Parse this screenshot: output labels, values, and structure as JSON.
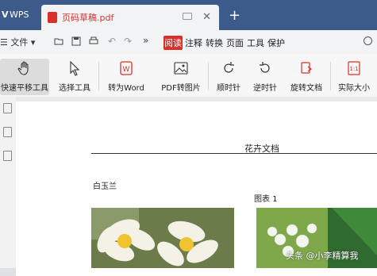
{
  "titlebar": {
    "wps_tab": "WPS",
    "doc_tab": "页码草稿.pdf",
    "new_tab": "+"
  },
  "menubar": {
    "file_label": "文件",
    "tabs": [
      "阅读",
      "注释",
      "转换",
      "页面",
      "工具",
      "保护"
    ],
    "active_tab": "阅读"
  },
  "toolbar": {
    "hand_tool": "快速平移工具",
    "select_tool": "选择工具",
    "to_word": "转为Word",
    "pdf_to_image": "PDF转图片",
    "rotate_cw": "顺时针",
    "rotate_ccw": "逆时针",
    "rotate_doc": "旋转文档",
    "actual_size": "实际大小"
  },
  "document": {
    "title": "花卉文档",
    "heading": "白玉兰",
    "caption": "图表 1"
  },
  "watermark": "头条 @小李精算我",
  "colors": {
    "titlebar": "#3c5a8a",
    "accent": "#d9302b"
  }
}
